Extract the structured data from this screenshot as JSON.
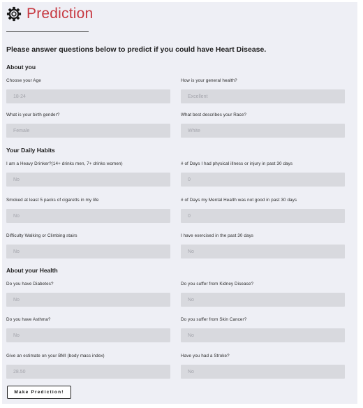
{
  "header": {
    "title": "Prediction",
    "icon": "gear-icon",
    "title_color": "#c73a42"
  },
  "intro": "Please answer questions below to predict if you could have Heart Disease.",
  "sections": {
    "about_you": "About you",
    "daily_habits": "Your Daily Habits",
    "about_health": "About your Health"
  },
  "fields": {
    "age": {
      "label": "Choose your Age",
      "value": "18-24"
    },
    "general_health": {
      "label": "How is your general health?",
      "value": "Excellent"
    },
    "birth_gender": {
      "label": "What is your birth gender?",
      "value": "Female"
    },
    "race": {
      "label": "What best describes your Race?",
      "value": "White"
    },
    "heavy_drinker": {
      "label": "I am a Heavy Drinker?(14+ drinks men, 7+ drinks women)",
      "value": "No"
    },
    "physical_illness_days": {
      "label": "# of Days I had physical illness or injury in past 30 days",
      "value": "0"
    },
    "smoked": {
      "label": "Smoked at least 5 packs of cigaretts in my life",
      "value": "No"
    },
    "mental_health_days": {
      "label": "# of Days my Mental Health was not good in past 30 days",
      "value": "0"
    },
    "difficulty_walking": {
      "label": "Difficulty Walking or Climbing stairs",
      "value": "No"
    },
    "exercised": {
      "label": "I have exercised in the past 30 days",
      "value": "No"
    },
    "diabetes": {
      "label": "Do you have Diabetes?",
      "value": "No"
    },
    "kidney_disease": {
      "label": "Do you suffer from Kidney Disease?",
      "value": "No"
    },
    "asthma": {
      "label": "Do you have Asthma?",
      "value": "No"
    },
    "skin_cancer": {
      "label": "Do you suffer from Skin Cancer?",
      "value": "No"
    },
    "bmi": {
      "label": "Give an estimate on your BMI (body mass index)",
      "value": "28.50"
    },
    "stroke": {
      "label": "Have you had a Stroke?",
      "value": "No"
    }
  },
  "submit_label": "Make Prediction!"
}
